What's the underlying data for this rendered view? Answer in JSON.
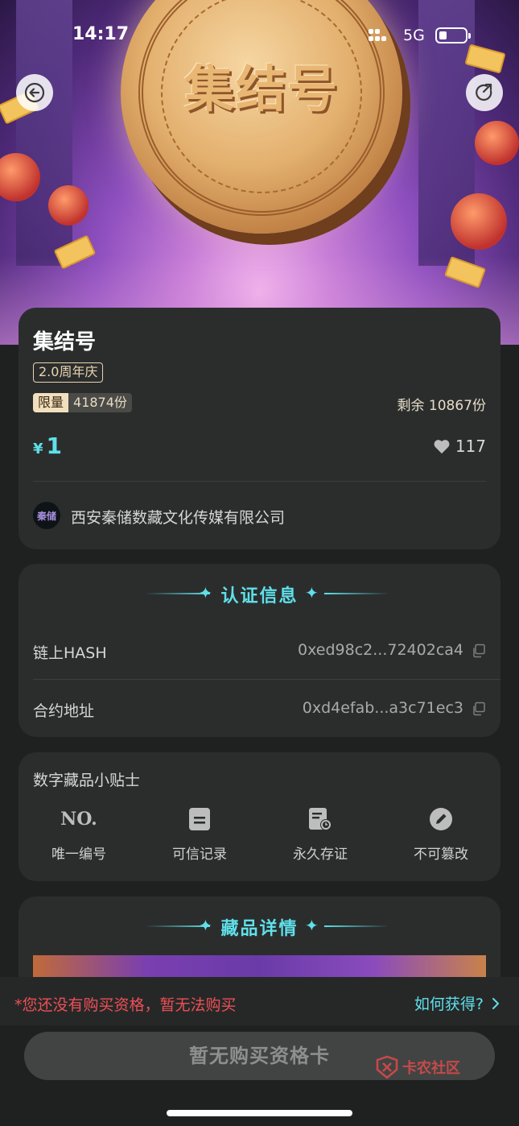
{
  "status_bar": {
    "time": "14:17",
    "network": "5G"
  },
  "hero": {
    "coin_text": "集结号"
  },
  "product": {
    "title": "集结号",
    "tag": "2.0周年庆",
    "limit_label": "限量",
    "limit_value": "41874份",
    "remaining": "剩余 10867份",
    "currency": "¥",
    "price": "1",
    "likes": "117",
    "issuer_logo_text": "秦储",
    "issuer": "西安秦储数藏文化传媒有限公司"
  },
  "certification": {
    "heading": "认证信息",
    "rows": [
      {
        "label": "链上HASH",
        "value": "0xed98c2...72402ca4"
      },
      {
        "label": "合约地址",
        "value": "0xd4efab...a3c71ec3"
      }
    ]
  },
  "tips": {
    "title": "数字藏品小贴士",
    "items": [
      {
        "icon": "number-icon",
        "label": "唯一编号"
      },
      {
        "icon": "document-icon",
        "label": "可信记录"
      },
      {
        "icon": "certificate-icon",
        "label": "永久存证"
      },
      {
        "icon": "pencil-icon",
        "label": "不可篡改"
      }
    ]
  },
  "detail": {
    "heading": "藏品详情"
  },
  "notice": {
    "text": "*您还没有购买资格，暂无法购买",
    "link": "如何获得?"
  },
  "buy_button": "暂无购买资格卡",
  "watermark": "卡农社区",
  "colors": {
    "accent": "#5fe0ea",
    "warning": "#ef4f55",
    "card_bg": "#2b2d2d",
    "page_bg": "#1f2121"
  }
}
